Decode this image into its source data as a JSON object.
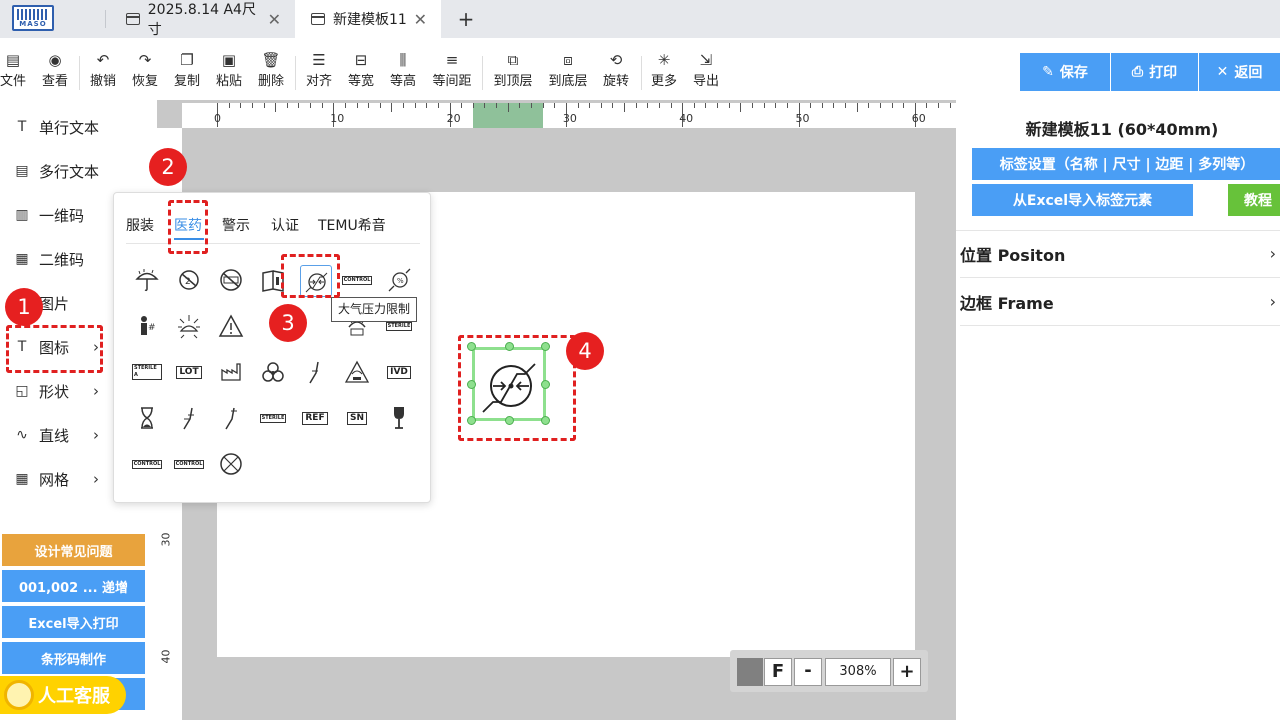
{
  "tabs": [
    {
      "label": "2025.8.14 A4尺寸",
      "active": false
    },
    {
      "label": "新建模板11",
      "active": true
    }
  ],
  "logo_text": "MASO",
  "toolbar": {
    "items": [
      {
        "icon": "file-icon",
        "label": "文件"
      },
      {
        "icon": "eye-icon",
        "label": "查看"
      },
      {
        "icon": "undo-icon",
        "label": "撤销"
      },
      {
        "icon": "redo-icon",
        "label": "恢复"
      },
      {
        "icon": "copy-icon",
        "label": "复制"
      },
      {
        "icon": "paste-icon",
        "label": "粘贴"
      },
      {
        "icon": "delete-icon",
        "label": "删除"
      },
      {
        "icon": "align-icon",
        "label": "对齐"
      },
      {
        "icon": "equal-width-icon",
        "label": "等宽"
      },
      {
        "icon": "equal-height-icon",
        "label": "等高"
      },
      {
        "icon": "equal-spacing-icon",
        "label": "等间距"
      },
      {
        "icon": "bring-front-icon",
        "label": "到顶层"
      },
      {
        "icon": "send-back-icon",
        "label": "到底层"
      },
      {
        "icon": "rotate-icon",
        "label": "旋转"
      },
      {
        "icon": "more-icon",
        "label": "更多"
      },
      {
        "icon": "export-icon",
        "label": "导出"
      }
    ],
    "save_label": "保存",
    "print_label": "打印",
    "back_label": "返回"
  },
  "sidebar": {
    "items": [
      {
        "icon": "text-icon",
        "label": "单行文本"
      },
      {
        "icon": "multiline-text-icon",
        "label": "多行文本"
      },
      {
        "icon": "barcode-icon",
        "label": "一维码"
      },
      {
        "icon": "qrcode-icon",
        "label": "二维码"
      },
      {
        "icon": "image-icon",
        "label": "图片"
      },
      {
        "icon": "icon-tool-icon",
        "label": "图标"
      },
      {
        "icon": "shape-icon",
        "label": "形状"
      },
      {
        "icon": "line-icon",
        "label": "直线"
      },
      {
        "icon": "grid-icon",
        "label": "网格"
      }
    ],
    "buttons": [
      {
        "label": "设计常见问题",
        "color": "#e8a33d"
      },
      {
        "label": "001,002 ... 递增",
        "color": "#4a9ef5"
      },
      {
        "label": "Excel导入打印",
        "color": "#4a9ef5"
      },
      {
        "label": "条形码制作",
        "color": "#4a9ef5"
      }
    ],
    "service_label": "人工客服"
  },
  "ruler": {
    "h_labels": [
      "0",
      "10",
      "20",
      "30",
      "40",
      "50",
      "60"
    ],
    "v_labels": [
      "30",
      "40"
    ]
  },
  "icon_popup": {
    "tabs": [
      "服装",
      "医药",
      "警示",
      "认证",
      "TEMU希音"
    ],
    "active_tab": "医药",
    "tooltip": "大气压力限制",
    "glyphs": {
      "control": "CONTROL",
      "sterile_a": "STERILE A",
      "sterile": "STERILE",
      "lot": "LOT",
      "ivd": "IVD",
      "ref": "REF",
      "sn": "SN",
      "percent": "%"
    }
  },
  "zoom": {
    "f_label": "F",
    "minus_label": "-",
    "value": "308%",
    "plus_label": "+"
  },
  "right_panel": {
    "title": "新建模板11 (60*40mm)",
    "label_settings": "标签设置（名称 | 尺寸 | 边距 | 多列等）",
    "excel_import": "从Excel导入标签元素",
    "tutorial": "教程",
    "sections": [
      "位置 Positon",
      "边框 Frame"
    ]
  },
  "annotations": [
    "1",
    "2",
    "3",
    "4"
  ],
  "colors": {
    "accent": "#4a9ef5",
    "annotation": "#e02020",
    "selection": "#8ee08e",
    "tutorial": "#67c23a"
  }
}
